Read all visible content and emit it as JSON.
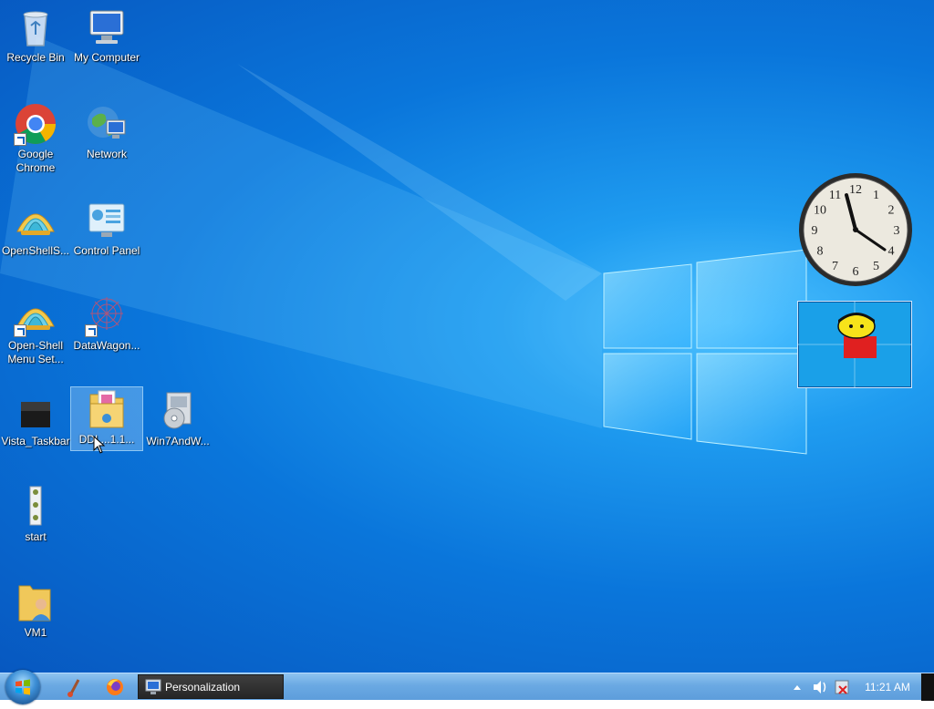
{
  "desktop": {
    "icons": [
      {
        "label": "Recycle Bin"
      },
      {
        "label": "My Computer"
      },
      {
        "label": "Google Chrome"
      },
      {
        "label": "Network"
      },
      {
        "label": "OpenShellS..."
      },
      {
        "label": "Control Panel"
      },
      {
        "label": "Open-Shell Menu Set..."
      },
      {
        "label": "DataWagon..."
      },
      {
        "label": "Vista_Taskbar"
      },
      {
        "label": "DDL...1.1..."
      },
      {
        "label": "Win7AndW..."
      },
      {
        "label": "start"
      },
      {
        "label": "VM1"
      }
    ]
  },
  "gadgets": {
    "clock": {
      "numerals": [
        "12",
        "1",
        "2",
        "3",
        "4",
        "5",
        "6",
        "7",
        "8",
        "9",
        "10",
        "11"
      ]
    }
  },
  "taskbar": {
    "open_window": "Personalization",
    "time": "11:21 AM"
  },
  "colors": {
    "desktop_accent": "#0a76db",
    "taskbar": "#6aa9e3",
    "active_task": "#262626"
  }
}
